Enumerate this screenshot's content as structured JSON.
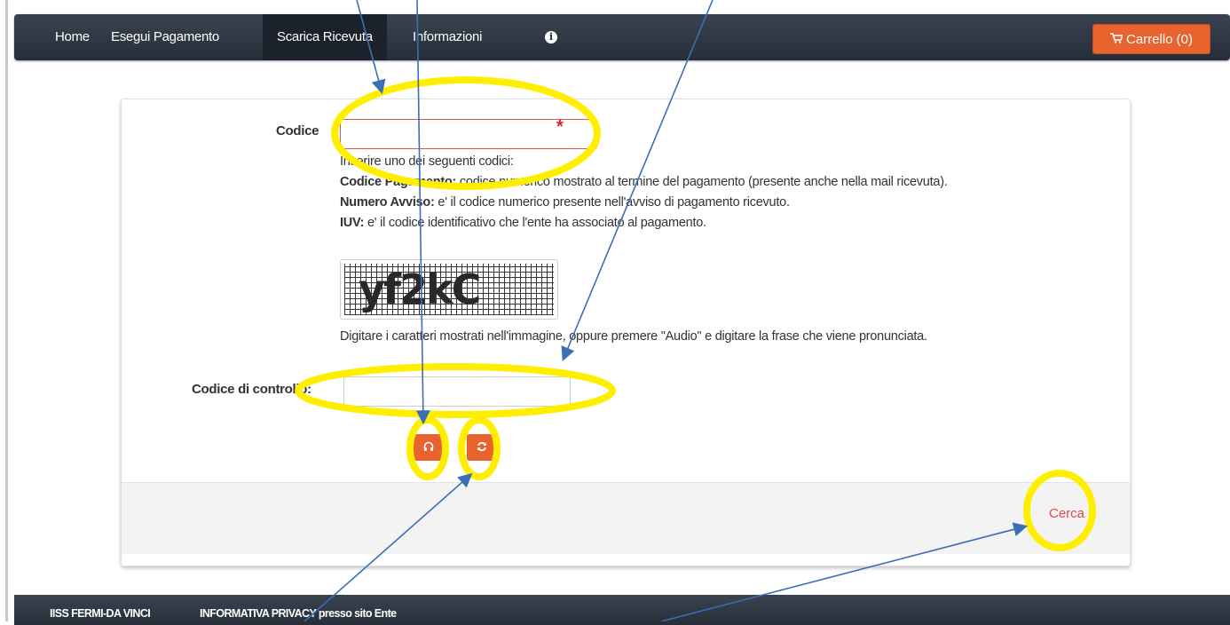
{
  "nav": {
    "items": [
      {
        "label": "Home",
        "active": false
      },
      {
        "label": "Esegui Pagamento",
        "active": false
      },
      {
        "label": "Scarica Ricevuta",
        "active": true
      },
      {
        "label": "Informazioni",
        "active": false
      }
    ],
    "info_icon": "info-circle-icon",
    "cart_label": "Carrello (0)",
    "cart_icon": "shopping-cart-icon"
  },
  "form": {
    "codice_label": "Codice",
    "codice_value": "",
    "required_marker": "*",
    "help": {
      "intro": "Inserire uno dei seguenti codici:",
      "codice_pagamento_term": "Codice Pagamento:",
      "codice_pagamento_text": " codice numerico mostrato al termine del pagamento (presente anche nella mail ricevuta).",
      "numero_avviso_term": "Numero Avviso:",
      "numero_avviso_text": " e' il codice numerico presente nell'avviso di pagamento ricevuto.",
      "iuv_term": "IUV:",
      "iuv_text": " e' il codice identificativo che l'ente ha associato al pagamento."
    },
    "captcha_text": "yf2kC",
    "captcha_hint": "Digitare i caratteri mostrati nell'immagine, oppure premere \"Audio\" e digitare la frase che viene pronunciata.",
    "controllo_label": "Codice di controllo:",
    "controllo_value": "",
    "audio_icon": "headphones-icon",
    "refresh_icon": "refresh-icon",
    "search_label": "Cerca"
  },
  "footer": {
    "org": "IISS FERMI-DA VINCI",
    "privacy": "INFORMATIVA PRIVACY presso sito Ente"
  },
  "colors": {
    "navbar": "#262e39",
    "accent": "#e8632e",
    "annotation_highlight": "#ffee00",
    "annotation_arrow": "#3a6fb5",
    "required": "#d9232f"
  }
}
